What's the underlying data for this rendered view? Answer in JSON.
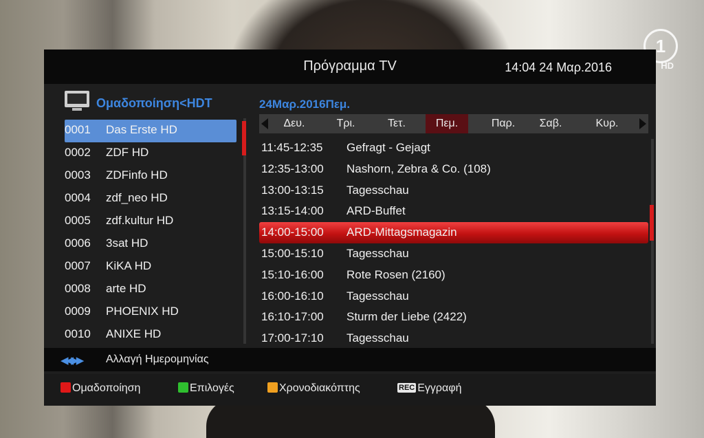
{
  "header": {
    "title": "Πρόγραμμα TV",
    "datetime": "14:04 24 Μαρ.2016"
  },
  "channel_panel": {
    "group_label": "Ομαδοποίηση<HDT",
    "selected_index": 0,
    "channels": [
      {
        "num": "0001",
        "name": "Das Erste HD"
      },
      {
        "num": "0002",
        "name": "ZDF HD"
      },
      {
        "num": "0003",
        "name": "ZDFinfo HD"
      },
      {
        "num": "0004",
        "name": "zdf_neo HD"
      },
      {
        "num": "0005",
        "name": "zdf.kultur HD"
      },
      {
        "num": "0006",
        "name": "3sat HD"
      },
      {
        "num": "0007",
        "name": "KiKA HD"
      },
      {
        "num": "0008",
        "name": "arte HD"
      },
      {
        "num": "0009",
        "name": "PHOENIX HD"
      },
      {
        "num": "0010",
        "name": "ANIXE HD"
      }
    ]
  },
  "epg": {
    "date_label": "24Μαρ.2016Πεμ.",
    "days": [
      "Δευ.",
      "Τρι.",
      "Τετ.",
      "Πεμ.",
      "Παρ.",
      "Σαβ.",
      "Κυρ."
    ],
    "selected_day": 3,
    "selected_program": 4,
    "programs": [
      {
        "time": "11:45-12:35",
        "title": "Gefragt - Gejagt"
      },
      {
        "time": "12:35-13:00",
        "title": "Nashorn, Zebra & Co. (108)"
      },
      {
        "time": "13:00-13:15",
        "title": "Tagesschau"
      },
      {
        "time": "13:15-14:00",
        "title": "ARD-Buffet"
      },
      {
        "time": "14:00-15:00",
        "title": "ARD-Mittagsmagazin"
      },
      {
        "time": "15:00-15:10",
        "title": "Tagesschau"
      },
      {
        "time": "15:10-16:00",
        "title": "Rote Rosen (2160)"
      },
      {
        "time": "16:00-16:10",
        "title": "Tagesschau"
      },
      {
        "time": "16:10-17:00",
        "title": "Sturm der Liebe (2422)"
      },
      {
        "time": "17:00-17:10",
        "title": "Tagesschau"
      }
    ]
  },
  "hint": {
    "icons": "◀◀ ▶▶",
    "text": "Αλλαγή Ημερομηνίας"
  },
  "footer": {
    "red": {
      "label": "Ομαδοποίηση",
      "color": "#e01818"
    },
    "green": {
      "label": "Επιλογές",
      "color": "#2fbf2f"
    },
    "yellow": {
      "label": "Χρονοδιακόπτης",
      "color": "#f0a020"
    },
    "rec": {
      "badge": "REC",
      "label": "Εγγραφή"
    }
  },
  "overlay": {
    "channel_logo": "1",
    "channel_logo_suffix": "HD"
  }
}
